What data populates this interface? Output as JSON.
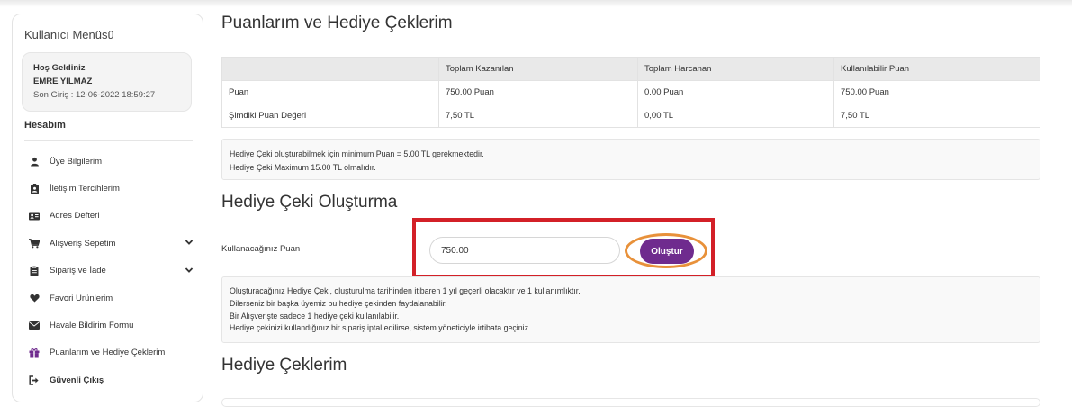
{
  "sidebar": {
    "title": "Kullanıcı Menüsü",
    "welcome": {
      "greeting": "Hoş Geldiniz",
      "user_name": "EMRE YILMAZ",
      "last_login": "Son Giriş : 12-06-2022 18:59:27"
    },
    "section_title": "Hesabım",
    "items": [
      {
        "label": "Üye Bilgilerim",
        "icon": "user-icon"
      },
      {
        "label": "İletişim Tercihlerim",
        "icon": "id-badge-icon"
      },
      {
        "label": "Adres Defteri",
        "icon": "address-card-icon"
      },
      {
        "label": "Alışveriş Sepetim",
        "icon": "cart-icon",
        "expandable": true
      },
      {
        "label": "Sipariş ve İade",
        "icon": "clipboard-icon",
        "expandable": true
      },
      {
        "label": "Favori Ürünlerim",
        "icon": "heart-icon"
      },
      {
        "label": "Havale Bildirim Formu",
        "icon": "envelope-icon"
      },
      {
        "label": "Puanlarım ve Hediye Çeklerim",
        "icon": "gift-icon",
        "active": true
      },
      {
        "label": "Güvenli Çıkış",
        "icon": "sign-out-icon"
      }
    ]
  },
  "main": {
    "page_title": "Puanlarım ve Hediye Çeklerim",
    "points_table": {
      "headers": [
        "",
        "Toplam Kazanılan",
        "Toplam Harcanan",
        "Kullanılabilir Puan"
      ],
      "rows": [
        [
          "Puan",
          "750.00 Puan",
          "0.00 Puan",
          "750.00 Puan"
        ],
        [
          "Şimdiki Puan Değeri",
          "7,50 TL",
          "0,00 TL",
          "7,50 TL"
        ]
      ]
    },
    "info_notes": [
      "Hediye Çeki oluşturabilmek için minimum Puan = 5.00 TL gerekmektedir.",
      "Hediye Çeki Maximum 15.00 TL olmalıdır."
    ],
    "create_section_title": "Hediye Çeki Oluşturma",
    "points_to_use_label": "Kullanacağınız Puan",
    "points_input_value": "750.00",
    "create_button_label": "Oluştur",
    "rules": [
      "Oluşturacağınız Hediye Çeki, oluşturulma tarihinden itibaren 1 yıl geçerli olacaktır ve 1 kullanımlıktır.",
      "Dilerseniz bir başka üyemiz bu hediye çekinden faydalanabilir.",
      "Bir Alışverişte sadece 1 hediye çeki kullanılabilir.",
      "Hediye çekinizi kullandığınız bir sipariş iptal edilirse, sistem yöneticiyle irtibata geçiniz."
    ],
    "vouchers_section_title": "Hediye Çeklerim"
  },
  "colors": {
    "accent_button": "#6f2b8e",
    "highlight_box": "#d32027",
    "highlight_ring": "#e8913a"
  }
}
